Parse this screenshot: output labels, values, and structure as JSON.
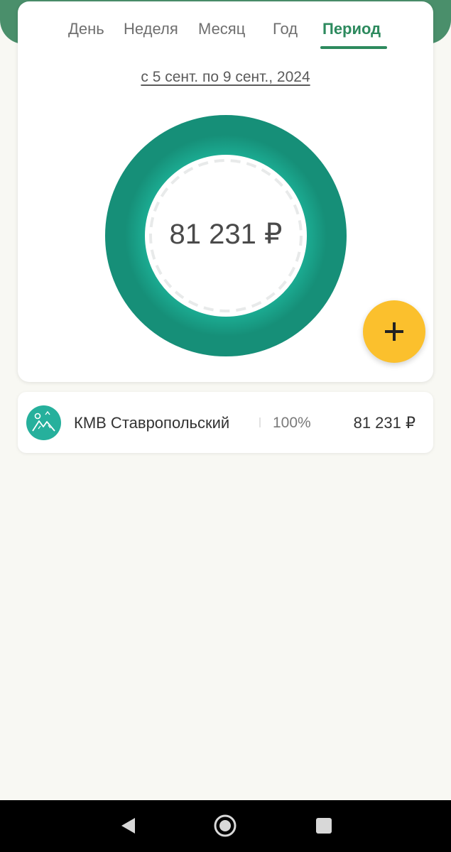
{
  "tabs": [
    {
      "label": "День",
      "active": false
    },
    {
      "label": "Неделя",
      "active": false
    },
    {
      "label": "Месяц",
      "active": false
    },
    {
      "label": "Год",
      "active": false
    },
    {
      "label": "Период",
      "active": true
    }
  ],
  "period": {
    "range_label": "с 5 сент. по 9 сент., 2024"
  },
  "chart": {
    "total": "81 231 ₽"
  },
  "fab": {
    "icon": "plus-icon"
  },
  "categories": [
    {
      "name": "КМВ Ставропольский",
      "percent": "100%",
      "amount": "81 231 ₽",
      "icon": "mountains-icon",
      "color": "#26b09c"
    }
  ],
  "colors": {
    "accent": "#2d8a5e",
    "ring": "#1fa891",
    "fab": "#fbc02d",
    "header": "#4a8f6b"
  },
  "navbar": {
    "back": "back-icon",
    "home": "home-icon",
    "recents": "recents-icon"
  }
}
